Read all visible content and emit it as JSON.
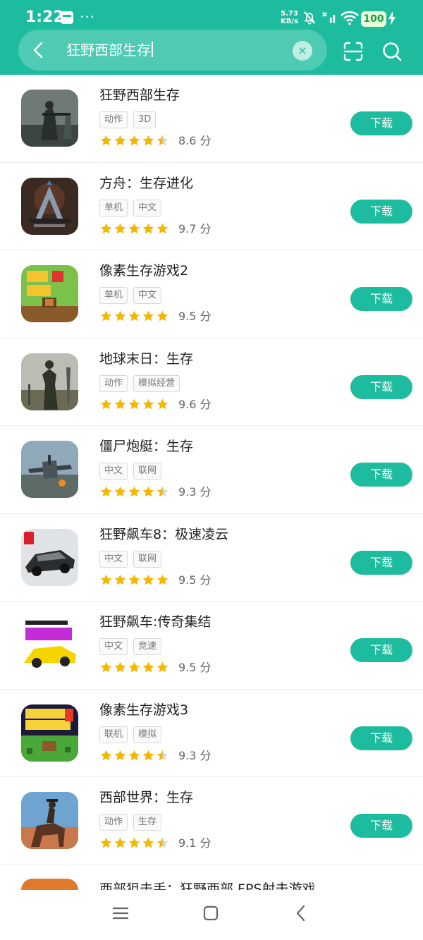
{
  "status_bar": {
    "time": "1:22",
    "dots": "···",
    "net_speed_value": "5.73",
    "net_speed_unit": "KB/s",
    "battery": "100"
  },
  "search": {
    "query": "狂野西部生存",
    "clear": "×"
  },
  "results": [
    {
      "name": "狂野西部生存",
      "tags": [
        "动作",
        "3D"
      ],
      "rating": 4.5,
      "score": "8.6 分",
      "download": "下载"
    },
    {
      "name": "方舟：生存进化",
      "tags": [
        "单机",
        "中文"
      ],
      "rating": 5,
      "score": "9.7 分",
      "download": "下载"
    },
    {
      "name": "像素生存游戏2",
      "tags": [
        "单机",
        "中文"
      ],
      "rating": 5,
      "score": "9.5 分",
      "download": "下载"
    },
    {
      "name": "地球末日：生存",
      "tags": [
        "动作",
        "模拟经营"
      ],
      "rating": 5,
      "score": "9.6 分",
      "download": "下载"
    },
    {
      "name": "僵尸炮艇：生存",
      "tags": [
        "中文",
        "联网"
      ],
      "rating": 4.5,
      "score": "9.3 分",
      "download": "下载"
    },
    {
      "name": "狂野飙车8：极速凌云",
      "tags": [
        "中文",
        "联网"
      ],
      "rating": 5,
      "score": "9.5 分",
      "download": "下载"
    },
    {
      "name": "狂野飙车:传奇集结",
      "tags": [
        "中文",
        "竞速"
      ],
      "rating": 5,
      "score": "9.5 分",
      "download": "下载"
    },
    {
      "name": "像素生存游戏3",
      "tags": [
        "联机",
        "模拟"
      ],
      "rating": 4.5,
      "score": "9.3 分",
      "download": "下载"
    },
    {
      "name": "西部世界：生存",
      "tags": [
        "动作",
        "生存"
      ],
      "rating": 4.5,
      "score": "9.1 分",
      "download": "下载"
    }
  ],
  "partial_result": {
    "name": "西部狙击手：狂野西部 FPS射击游戏"
  },
  "colors": {
    "accent": "#1ebc9e",
    "star": "#f5b600",
    "star_empty": "#d6d6d6"
  }
}
